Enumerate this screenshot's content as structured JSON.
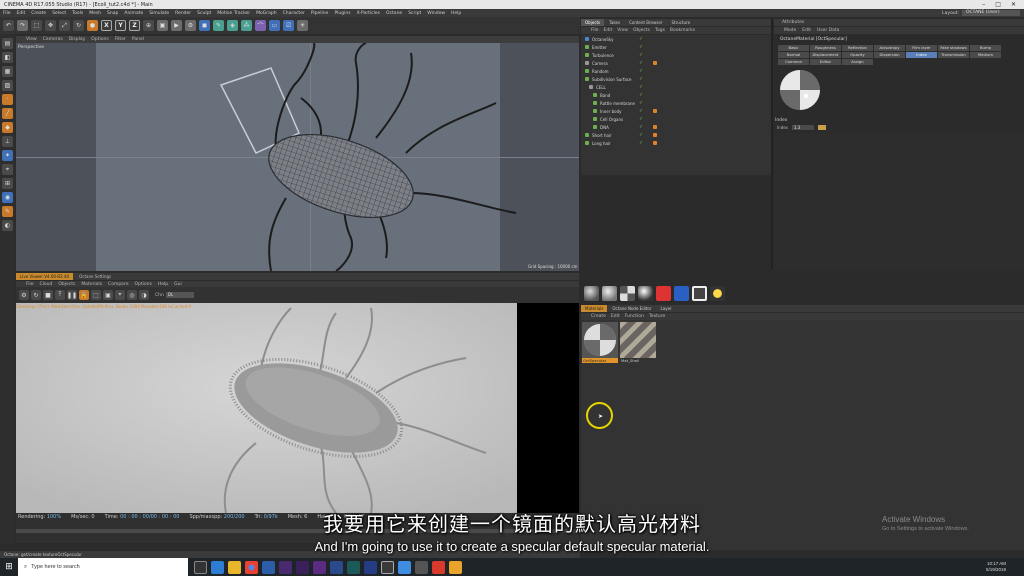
{
  "window": {
    "title": "CINEMA 4D R17.055 Studio (R17) - [Ecoli_tut2.c4d *] - Main",
    "controls": [
      "–",
      "□",
      "✕"
    ]
  },
  "menubar": {
    "items": [
      "File",
      "Edit",
      "Create",
      "Select",
      "Tools",
      "Mesh",
      "Snap",
      "Animate",
      "Simulate",
      "Render",
      "Sculpt",
      "Motion Tracker",
      "MoGraph",
      "Character",
      "Pipeline",
      "Plugins",
      "X-Particles",
      "Octane",
      "Script",
      "Window",
      "Help"
    ],
    "layout_label": "Layout:",
    "layout_value": "OCTANE (User)"
  },
  "viewport": {
    "menu": [
      "View",
      "Cameras",
      "Display",
      "Options",
      "Filter",
      "Panel"
    ],
    "label": "Perspective",
    "grid_spacing": "Grid Spacing : 10000 cm"
  },
  "liveviewer": {
    "tabs": [
      "Live Viewer V4.00-R2.40",
      "Octane Settings"
    ],
    "menu": [
      "File",
      "Cloud",
      "Objects",
      "Materials",
      "Compare",
      "Options",
      "Help",
      "Gui"
    ],
    "chn_label": "Chn",
    "chn_value": "DL",
    "status": "Checking: (7ms). MeshGen:0ms. Update(M):0ms. Nodes:1084 Movable:636 txCached:0",
    "stats": {
      "rendering": "Rendering:",
      "rendering_val": "100%",
      "mssec": "Ms/sec: 0",
      "time_lbl": "Time:",
      "time_val": "00 : 00 : 00/00 : 00 : 00",
      "spp_lbl": "Spp/maxspp:",
      "spp_val": "200/200",
      "tri_lbl": "Tri:",
      "tri_val": "0/97k",
      "mesh_lbl": "Mesh: 6",
      "hair": "Hair: 0",
      "gpu": "GPU: 47"
    }
  },
  "statusbar": "Octane: get/create textureOctSpecular",
  "objects": {
    "tabs": [
      "Objects",
      "Takes",
      "Content Browser",
      "Structure"
    ],
    "menu": [
      "File",
      "Edit",
      "View",
      "Objects",
      "Tags",
      "Bookmarks"
    ],
    "items": [
      "OctaneSky",
      "Emitter",
      "Turbulence",
      "Camera",
      "Random",
      "Subdivision Surface",
      "CELL",
      "Band",
      "Rattle membrane",
      "Inner body",
      "Cell Organs",
      "DNA",
      "Short hair",
      "Long hair"
    ]
  },
  "attributes": {
    "title": "Attributes",
    "menu": [
      "Mode",
      "Edit",
      "User Data"
    ],
    "material_name": "OctaneMaterial [OctSpecular]",
    "channels_row1": [
      "Basic",
      "Roughness",
      "Reflection",
      "Anisotropy",
      "Film layer",
      "Fake shadows",
      "Bump"
    ],
    "channels_row2": [
      "Normal",
      "Displacement",
      "Opacity",
      "Dispersion",
      "Index",
      "Transmission",
      "Medium"
    ],
    "channels_row3": [
      "Common",
      "Editor",
      "Assign"
    ],
    "index_section": "Index",
    "index_label": "Index",
    "index_value": "1.3"
  },
  "materials": {
    "tabs": [
      "Materials",
      "Octane Node Editor",
      "Layer"
    ],
    "menu": [
      "Create",
      "Edit",
      "Function",
      "Texture"
    ],
    "items": [
      {
        "label": "OctSpecular",
        "selected": true
      },
      {
        "label": "Mat_Shell",
        "selected": false
      }
    ]
  },
  "subtitles": {
    "cn": "我要用它来创建一个镜面的默认高光材料",
    "en": "And I'm going to use it to create a specular default specular material."
  },
  "watermark": {
    "line1": "Activate Windows",
    "line2": "Go to Settings to activate Windows."
  },
  "taskbar": {
    "search_placeholder": "Type here to search",
    "time": "10:17 AM",
    "date": "5/19/2019"
  },
  "colors": {
    "accent": "#c88a2c",
    "selected_channel": "#5a7fb8",
    "cursor_ring": "#e6d600"
  }
}
